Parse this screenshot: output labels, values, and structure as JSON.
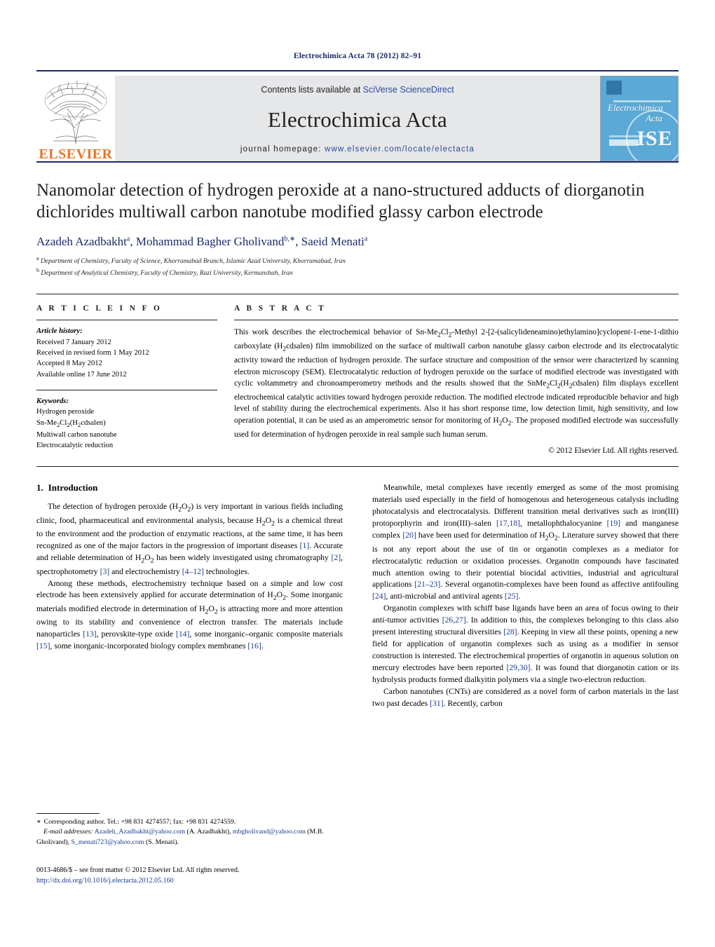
{
  "running_head": "Electrochimica Acta 78 (2012) 82–91",
  "masthead": {
    "contents_prefix": "Contents lists available at ",
    "contents_link": "SciVerse ScienceDirect",
    "journal_name": "Electrochimica Acta",
    "homepage_prefix": "journal homepage: ",
    "homepage_url": "www.elsevier.com/locate/electacta",
    "publisher_logo_text": "ELSEVIER",
    "cover": {
      "title_line1": "Electrochimica",
      "title_line2": "Acta",
      "society_mark": "ISE"
    },
    "colors": {
      "rule": "#1b2a6b",
      "band_bg": "#e6e7e9",
      "link": "#2b4a9b",
      "elsevier_orange": "#e87424",
      "cover_blue": "#5aa9d6"
    }
  },
  "article": {
    "title": "Nanomolar detection of hydrogen peroxide at a nano-structured adducts of diorganotin dichlorides multiwall carbon nanotube modified glassy carbon electrode",
    "authors_html": "Azadeh Azadbakht<sup>a</sup>, Mohammad Bagher Gholivand<sup>b,</sup><sup>∗</sup>, Saeid Menati<sup>a</sup>",
    "affiliations": [
      {
        "marker": "a",
        "text": "Department of Chemistry, Faculty of Science, Khorramabad Branch, Islamic Azad University, Khorramabad, Iran"
      },
      {
        "marker": "b",
        "text": "Department of Analytical Chemistry, Faculty of Chemistry, Razi University, Kermanshah, Iran"
      }
    ]
  },
  "article_info": {
    "heading": "A R T I C L E  I N F O",
    "history_label": "Article history:",
    "history": [
      "Received 7 January 2012",
      "Received in revised form 1 May 2012",
      "Accepted 8 May 2012",
      "Available online 17 June 2012"
    ],
    "keywords_label": "Keywords:",
    "keywords_html": [
      "Hydrogen peroxide",
      "Sn-Me<sub>2</sub>Cl<sub>2</sub>(H<sub>2</sub>cdsalen)",
      "Multiwall carbon nanotube",
      "Electrocatalytic reduction"
    ]
  },
  "abstract": {
    "heading": "A B S T R A C T",
    "text_html": "This work describes the electrochemical behavior of Sn-Me<sub>2</sub>Cl<sub>2</sub>-Methyl 2-[2-(salicylideneamino)ethylamino]cyclopent-1-ene-1-dithio carboxylate (H<sub>2</sub>cdsalen) film immobilized on the surface of multiwall carbon nanotube glassy carbon electrode and its electrocatalytic activity toward the reduction of hydrogen peroxide. The surface structure and composition of the sensor were characterized by scanning electron microscopy (SEM). Electrocatalytic reduction of hydrogen peroxide on the surface of modified electrode was investigated with cyclic voltammetry and chronoamperometry methods and the results showed that the SnMe<sub>2</sub>Cl<sub>2</sub>(H<sub>2</sub>cdsalen) film displays excellent electrochemical catalytic activities toward hydrogen peroxide reduction. The modified electrode indicated reproducible behavior and high level of stability during the electrochemical experiments. Also it has short response time, low detection limit, high sensitivity, and low operation potential, it can be used as an amperometric sensor for monitoring of H<sub>2</sub>O<sub>2</sub>. The proposed modified electrode was successfully used for determination of hydrogen peroxide in real sample such human serum.",
    "copyright": "© 2012 Elsevier Ltd. All rights reserved."
  },
  "body": {
    "section_number": "1.",
    "section_title": "Introduction",
    "left_paragraphs_html": [
      "The detection of hydrogen peroxide (H<sub>2</sub>O<sub>2</sub>) is very important in various fields including clinic, food, pharmaceutical and environmental analysis, because H<sub>2</sub>O<sub>2</sub> is a chemical threat to the environment and the production of enzymatic reactions, at the same time, it has been recognized as one of the major factors in the progression of important diseases <span class=\"ref\">[1]</span>. Accurate and reliable determination of H<sub>2</sub>O<sub>2</sub> has been widely investigated using chromatography <span class=\"ref\">[2]</span>, spectrophotometry <span class=\"ref\">[3]</span> and electrochemistry <span class=\"ref\">[4–12]</span> technologies.",
      "Among these methods, electrochemistry technique based on a simple and low cost electrode has been extensively applied for accurate determination of H<sub>2</sub>O<sub>2</sub>. Some inorganic materials modified electrode in determination of H<sub>2</sub>O<sub>2</sub> is attracting more and more attention owing to its stability and convenience of electron transfer. The materials include nanoparticles <span class=\"ref\">[13]</span>, perovskite-type oxide <span class=\"ref\">[14]</span>, some inorganic–organic composite materials <span class=\"ref\">[15]</span>, some inorganic-incorporated biology complex membranes <span class=\"ref\">[16]</span>."
    ],
    "right_paragraphs_html": [
      "Meanwhile, metal complexes have recently emerged as some of the most promising materials used especially in the field of homogenous and heterogeneous catalysis including photocatalysis and electrocatalysis. Different transition metal derivatives such as iron(III) protoporphyrin and iron(III)–salen <span class=\"ref\">[17,18]</span>, metallophthalocyanine <span class=\"ref\">[19]</span> and manganese complex <span class=\"ref\">[20]</span> have been used for determination of H<sub>2</sub>O<sub>2</sub>. Literature survey showed that there is not any report about the use of tin or organotin complexes as a mediator for electrocatalytic reduction or oxidation processes. Organotin compounds have fascinated much attention owing to their potential biocidal activities, industrial and agricultural applications <span class=\"ref\">[21–23]</span>. Several organotin-complexes have been found as affective antifouling <span class=\"ref\">[24]</span>, anti-microbial and antiviral agents <span class=\"ref\">[25]</span>.",
      "Organotin complexes with schiff base ligands have been an area of focus owing to their anti-tumor activities <span class=\"ref\">[26,27]</span>. In addition to this, the complexes belonging to this class also present interesting structural diversities <span class=\"ref\">[28]</span>. Keeping in view all these points, opening a new field for application of organotin complexes such as using as a modifier in sensor construction is interested. The electrochemical properties of organotin in aqueous solution on mercury electrodes have been reported <span class=\"ref\">[29,30]</span>. It was found that diorganotin cation or its hydrolysis products formed dialkyitin polymers via a single two-electron reduction.",
      "Carbon nanotubes (CNTs) are considered as a novel form of carbon materials in the last two past decades <span class=\"ref\">[31]</span>. Recently, carbon"
    ]
  },
  "footnote": {
    "star": "∗",
    "corresponding_html": "Corresponding author. Tel.: +98 831 4274557; fax: +98 831 4274559.",
    "emails_label": "E-mail addresses:",
    "emails_html": "<span class=\"ref\">Azadeh_Azadbakht@yahoo.com</span> (A. Azadbakht), <span class=\"ref\">mbgholivand@yahoo.com</span> (M.B. Gholivand), <span class=\"ref\">S_menati723@yahoo.com</span> (S. Menati)."
  },
  "footer": {
    "issn_line": "0013-4686/$ – see front matter © 2012 Elsevier Ltd. All rights reserved.",
    "doi": "http://dx.doi.org/10.1016/j.electacta.2012.05.160"
  }
}
